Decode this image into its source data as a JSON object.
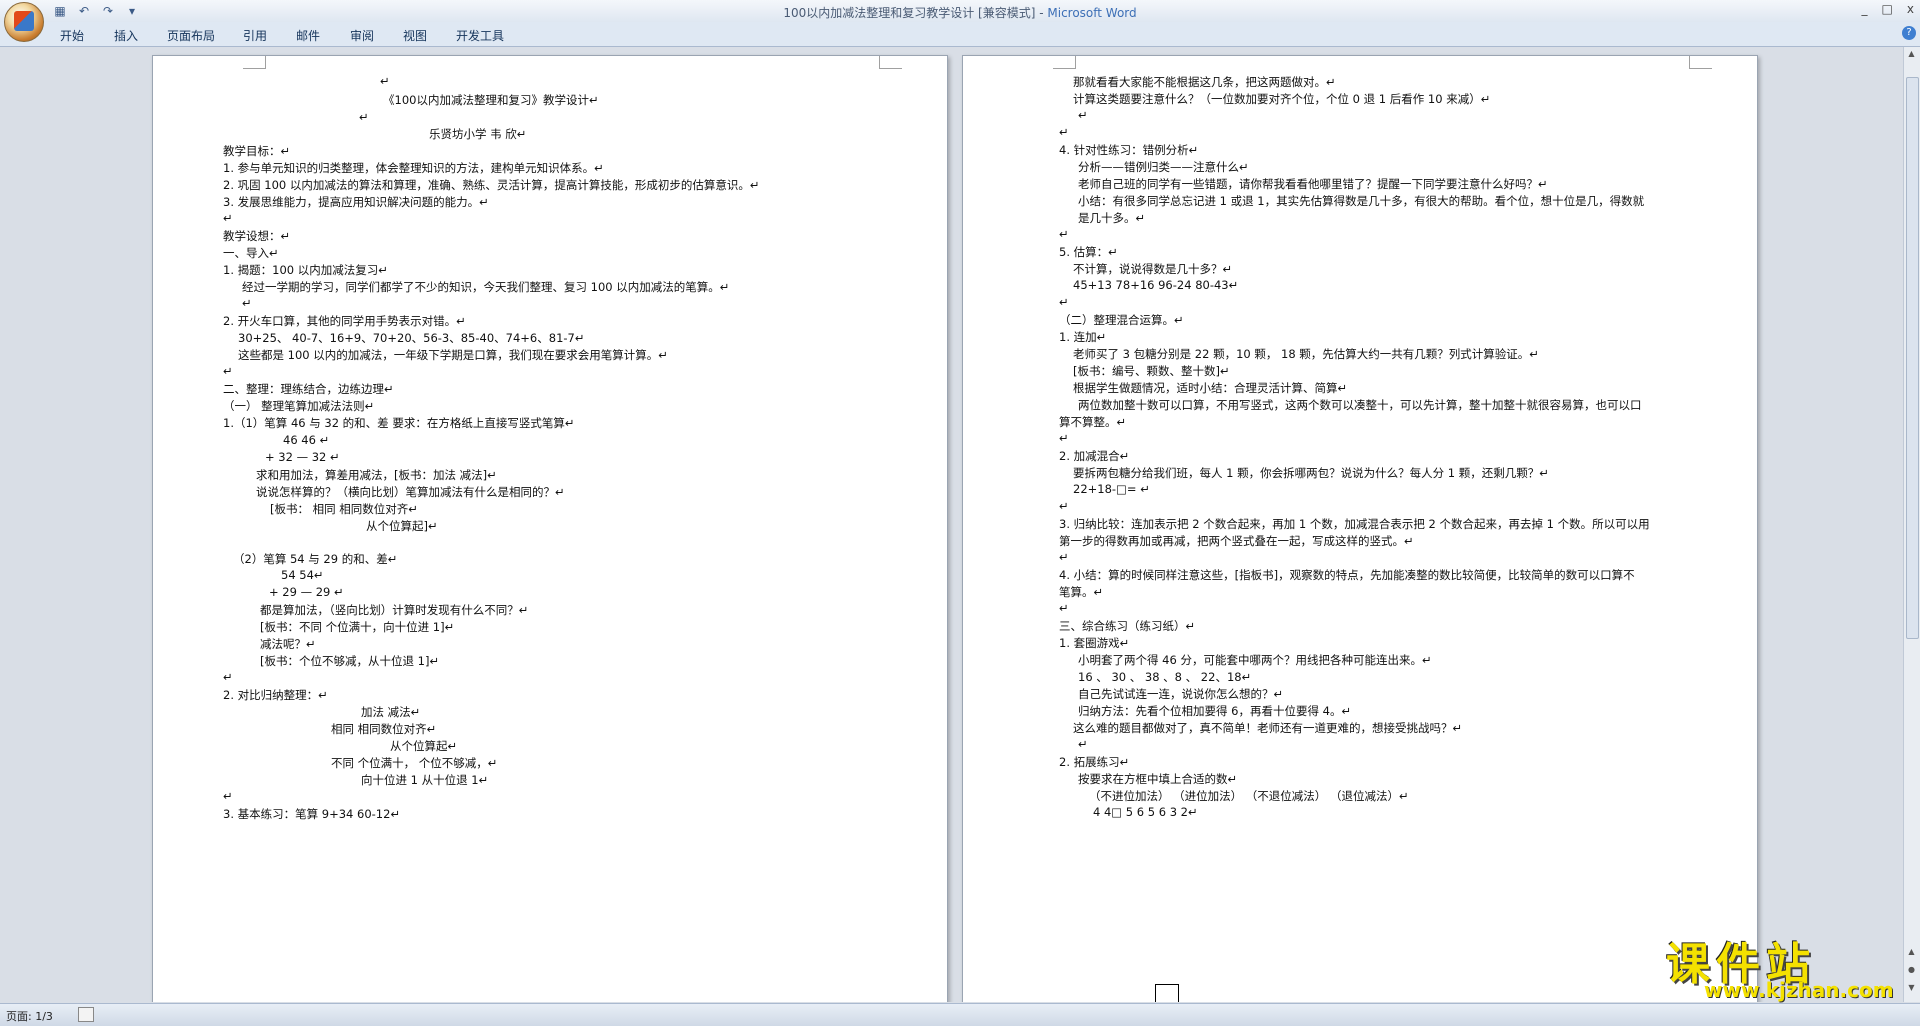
{
  "window": {
    "title": "100以内加减法整理和复习教学设计 [兼容模式] - ",
    "app": "Microsoft Word",
    "controls": [
      "_",
      "□",
      "x"
    ]
  },
  "ribbon": {
    "tabs": [
      "开始",
      "插入",
      "页面布局",
      "引用",
      "邮件",
      "审阅",
      "视图",
      "开发工具"
    ]
  },
  "status": {
    "page": "页面: 1/3"
  },
  "logo": {
    "cn": "课件站",
    "url": "www.kjzhan.com"
  },
  "page1": [
    "↵",
    "《100以内加减法整理和复习》教学设计↵",
    "↵",
    "乐贤坊小学 韦 欣↵",
    "教学目标：↵",
    "1.   参与单元知识的归类整理，体会整理知识的方法，建构单元知识体系。↵",
    "2.   巩固 100 以内加减法的算法和算理，准确、熟练、灵活计算，提高计算技能，形成初步的估算意识。↵",
    "3.   发展思维能力，提高应用知识解决问题的能力。↵",
    "↵",
    "教学设想：↵",
    "一、导入↵",
    "1.   揭题：100 以内加减法复习↵",
    "经过一学期的学习，同学们都学了不少的知识，今天我们整理、复习 100 以内加减法的笔算。↵",
    "↵",
    "2.   开火车口算，其他的同学用手势表示对错。↵",
    "30+25、 40-7、16+9、70+20、56-3、85-40、74+6、81-7↵",
    "这些都是 100 以内的加减法，一年级下学期是口算，我们现在要求会用笔算计算。↵",
    "↵",
    "二、整理：理练结合，边练边理↵",
    "（一）  整理笔算加减法法则↵",
    "1.（1）笔算 46 与 32 的和、差        要求：在方格纸上直接写竖式笔算↵",
    "46                46     ↵",
    "+  32          —  32  ↵",
    "求和用加法，算差用减法，[板书：加法    减法]↵",
    "说说怎样算的？（横向比划）笔算加减法有什么是相同的？↵",
    "[板书：  相同          相同数位对齐↵",
    "从个位算起]↵",
    "（2）笔算 54 与 29 的和、差↵",
    "54                54↵",
    "+  29          —  29  ↵",
    "都是算加法，（竖向比划）计算时发现有什么不同？↵",
    "[板书：不同    个位满十，向十位进 1]↵",
    "减法呢？↵",
    "[板书：个位不够减，从十位退 1]↵",
    "↵",
    "2. 对比归纳整理：↵",
    "加法              减法↵",
    "相同          相同数位对齐↵",
    "从个位算起↵",
    "不同    个位满十，        个位不够减，↵",
    "向十位进 1        从十位退 1↵",
    "↵",
    "3. 基本练习：笔算 9+34      60-12↵"
  ],
  "page2": [
    "那就看看大家能不能根据这几条，把这两题做对。↵",
    "计算这类题要注意什么？（一位数加要对齐个位，个位 0 退 1 后看作 10 来减）↵",
    "↵",
    "↵",
    "4.   针对性练习：错例分析↵",
    "分析——错例归类——注意什么↵",
    "老师自己班的同学有一些错题，请你帮我看看他哪里错了？提醒一下同学要注意什么好吗？↵",
    "小结：有很多同学总忘记进 1 或退 1，其实先估算得数是几十多，有很大的帮助。看个位，想十位是几，得数就",
    "是几十多。↵",
    "↵",
    "5. 估算：↵",
    "不计算，说说得数是几十多？↵",
    "45+13    78+16      96-24      80-43↵",
    "↵",
    "（二）整理混合运算。↵",
    "1. 连加↵",
    "老师买了 3 包糖分别是 22 颗，10 颗，  18 颗，先估算大约一共有几颗？列式计算验证。↵",
    "[板书：编号、颗数、整十数]↵",
    "根据学生做题情况，适时小结：合理灵活计算、简算↵",
    "两位数加整十数可以口算，不用写竖式，这两个数可以凑整十，可以先计算，整十加整十就很容易算，也可以口",
    "算不算整。↵",
    "↵",
    "2. 加减混合↵",
    "要拆两包糖分给我们班，每人 1 颗，你会拆哪两包？说说为什么？每人分 1 颗，还剩几颗？↵",
    "22+18-□=  ↵",
    "↵",
    "3. 归纳比较：连加表示把 2 个数合起来，再加 1 个数，加减混合表示把 2 个数合起来，再去掉 1 个数。所以可以用",
    "第一步的得数再加或再减，把两个竖式叠在一起，写成这样的竖式。↵",
    "↵",
    "4. 小结：算的时候同样注意这些，[指板书]，观察数的特点，先加能凑整的数比较简便，比较简单的数可以口算不",
    "笔算。↵",
    "↵",
    "三、综合练习（练习纸）↵",
    "1.    套圈游戏↵",
    "小明套了两个得 46 分，可能套中哪两个？用线把各种可能连出来。↵",
    "16   、 30   、 38   、8   、  22、18↵",
    "自己先试试连一连，说说你怎么想的？↵",
    "归纳方法：先看个位相加要得 6，再看十位要得 4。↵",
    "这么难的题目都做对了，真不简单！老师还有一道更难的，想接受挑战吗？↵",
    "↵",
    "2.    拓展练习↵",
    "按要求在方框中填上合适的数↵",
    "（不进位加法）      （进位加法）          （不退位减法）      （退位减法）↵",
    "4                  4□        5 6        5 6        3 2↵"
  ]
}
